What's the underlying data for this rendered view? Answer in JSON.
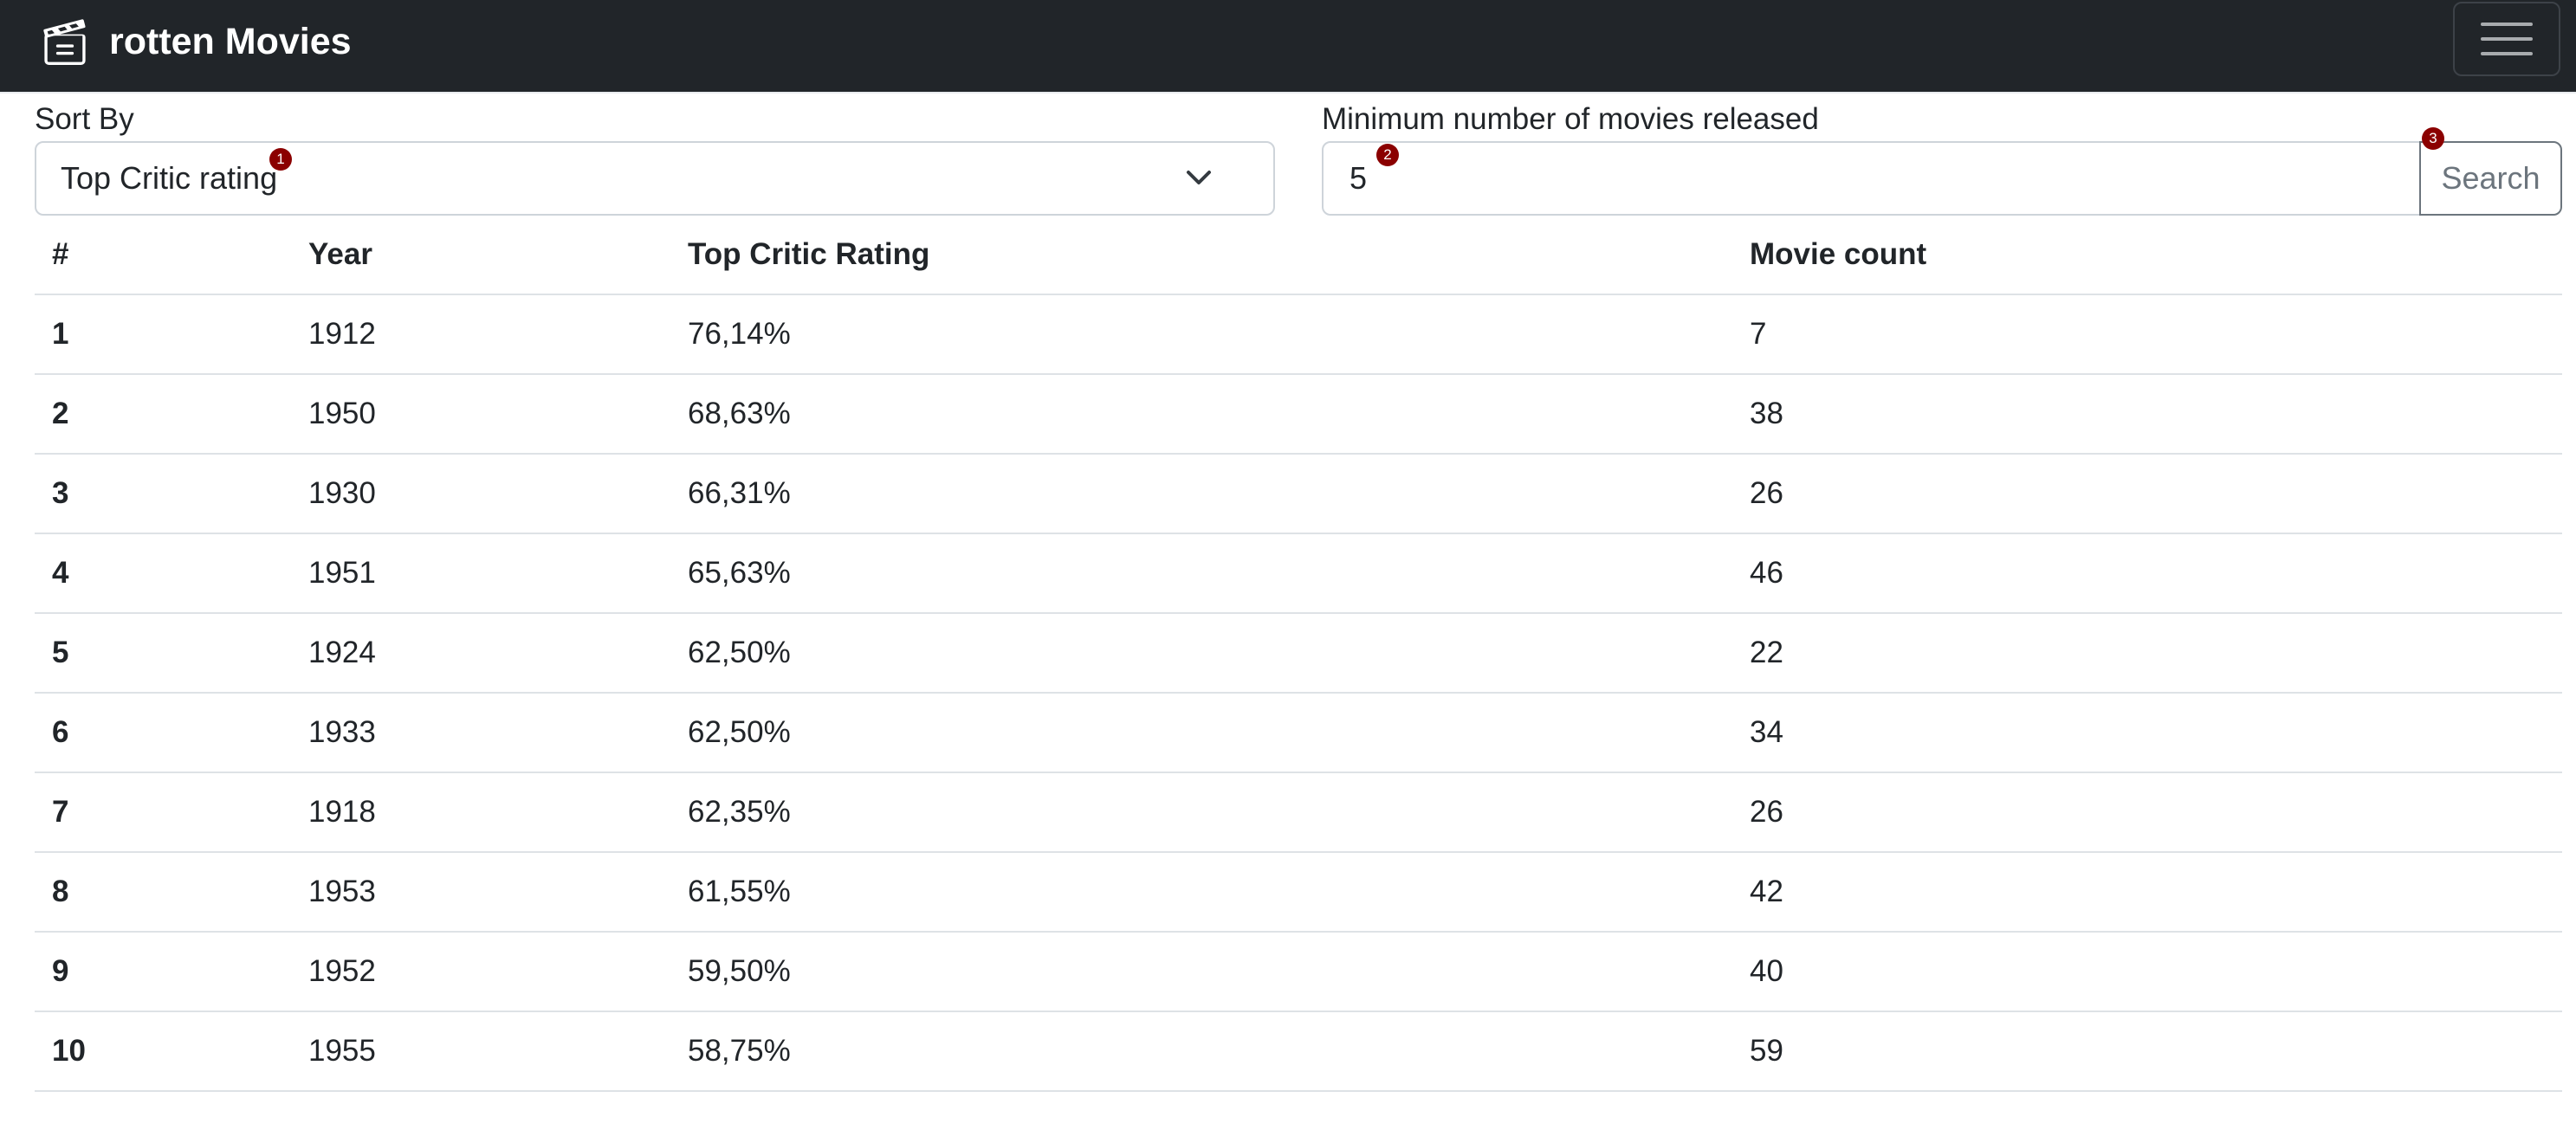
{
  "navbar": {
    "brand_icon": "clapperboard-icon",
    "brand_text": "rotten Movies",
    "toggler_icon": "hamburger-menu-icon",
    "colors": {
      "background": "#212529",
      "text": "#ffffff"
    }
  },
  "filters": {
    "sort_by": {
      "label": "Sort By",
      "selected": "Top Critic rating",
      "icon": "chevron-down-icon",
      "badge": "1"
    },
    "min_movies": {
      "label": "Minimum number of movies released",
      "value": "5",
      "badge": "2"
    },
    "search": {
      "label": "Search",
      "badge": "3"
    },
    "badge_color": "#8b0000"
  },
  "table": {
    "headers": [
      "#",
      "Year",
      "Top Critic Rating",
      "Movie count"
    ],
    "rows": [
      {
        "rank": "1",
        "year": "1912",
        "rating": "76,14%",
        "count": "7"
      },
      {
        "rank": "2",
        "year": "1950",
        "rating": "68,63%",
        "count": "38"
      },
      {
        "rank": "3",
        "year": "1930",
        "rating": "66,31%",
        "count": "26"
      },
      {
        "rank": "4",
        "year": "1951",
        "rating": "65,63%",
        "count": "46"
      },
      {
        "rank": "5",
        "year": "1924",
        "rating": "62,50%",
        "count": "22"
      },
      {
        "rank": "6",
        "year": "1933",
        "rating": "62,50%",
        "count": "34"
      },
      {
        "rank": "7",
        "year": "1918",
        "rating": "62,35%",
        "count": "26"
      },
      {
        "rank": "8",
        "year": "1953",
        "rating": "61,55%",
        "count": "42"
      },
      {
        "rank": "9",
        "year": "1952",
        "rating": "59,50%",
        "count": "40"
      },
      {
        "rank": "10",
        "year": "1955",
        "rating": "58,75%",
        "count": "59"
      }
    ]
  }
}
